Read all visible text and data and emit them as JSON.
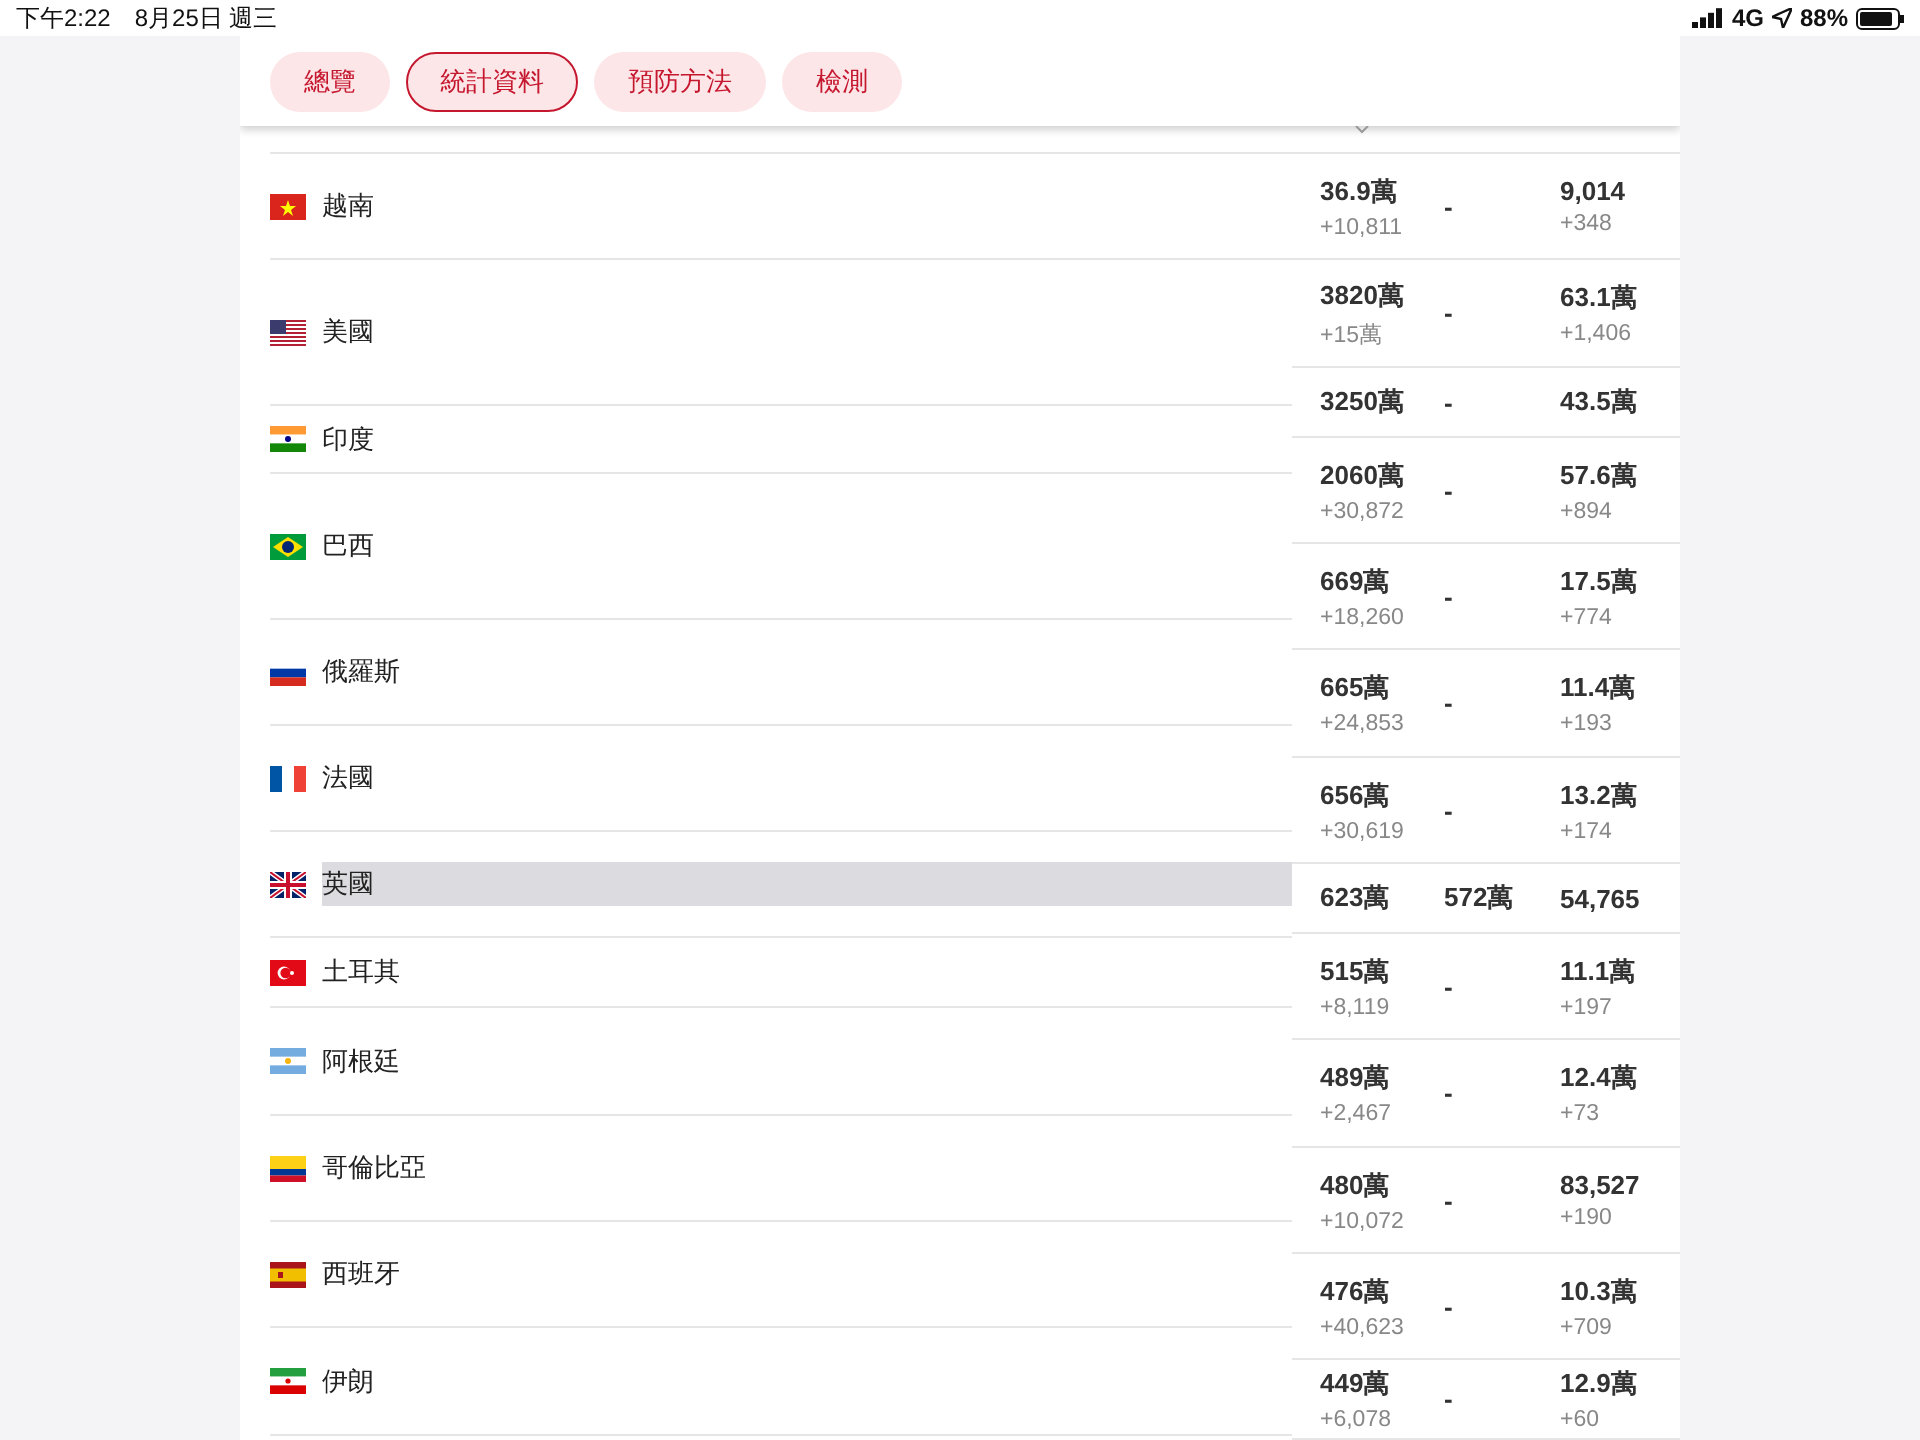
{
  "status_bar": {
    "time": "下午2:22",
    "date": "8月25日 週三",
    "network": "4G",
    "battery": "88%"
  },
  "tabs": [
    {
      "label": "總覽",
      "selected": false
    },
    {
      "label": "統計資料",
      "selected": true
    },
    {
      "label": "預防方法",
      "selected": false
    },
    {
      "label": "檢測",
      "selected": false
    }
  ],
  "table": {
    "names": [
      {
        "name": "越南",
        "selected": false
      },
      {
        "name": "美國",
        "selected": false
      },
      {
        "name": "印度",
        "selected": false
      },
      {
        "name": "巴西",
        "selected": false
      },
      {
        "name": "俄羅斯",
        "selected": false
      },
      {
        "name": "法國",
        "selected": false
      },
      {
        "name": "英國",
        "selected": true
      },
      {
        "name": "土耳其",
        "selected": false
      },
      {
        "name": "阿根廷",
        "selected": false
      },
      {
        "name": "哥倫比亞",
        "selected": false
      },
      {
        "name": "西班牙",
        "selected": false
      },
      {
        "name": "伊朗",
        "selected": false
      }
    ],
    "rows": [
      {
        "column_1": "36.9萬",
        "column_1_change": "+10,811",
        "column_2": "-",
        "column_3": "9,014",
        "column_3_change": "+348"
      },
      {
        "column_1": "3820萬",
        "column_1_change": "+15萬",
        "column_2": "-",
        "column_3": "63.1萬",
        "column_3_change": "+1,406"
      },
      {
        "column_1": "3250萬",
        "column_2": "-",
        "column_3": "43.5萬"
      },
      {
        "column_1": "2060萬",
        "column_1_change": "+30,872",
        "column_2": "-",
        "column_3": "57.6萬",
        "column_3_change": "+894"
      },
      {
        "column_1": "669萬",
        "column_1_change": "+18,260",
        "column_2": "-",
        "column_3": "17.5萬",
        "column_3_change": "+774"
      },
      {
        "column_1": "665萬",
        "column_1_change": "+24,853",
        "column_2": "-",
        "column_3": "11.4萬",
        "column_3_change": "+193"
      },
      {
        "column_1": "656萬",
        "column_1_change": "+30,619",
        "column_2": "-",
        "column_3": "13.2萬",
        "column_3_change": "+174"
      },
      {
        "column_1": "623萬",
        "column_2": "572萬",
        "column_3": "54,765"
      },
      {
        "column_1": "515萬",
        "column_1_change": "+8,119",
        "column_2": "-",
        "column_3": "11.1萬",
        "column_3_change": "+197"
      },
      {
        "column_1": "489萬",
        "column_1_change": "+2,467",
        "column_2": "-",
        "column_3": "12.4萬",
        "column_3_change": "+73"
      },
      {
        "column_1": "480萬",
        "column_1_change": "+10,072",
        "column_2": "-",
        "column_3": "83,527",
        "column_3_change": "+190"
      },
      {
        "column_1": "476萬",
        "column_1_change": "+40,623",
        "column_2": "-",
        "column_3": "10.3萬",
        "column_3_change": "+709"
      },
      {
        "column_1": "449萬",
        "column_1_change": "+6,078",
        "column_2": "-",
        "column_3": "12.9萬",
        "column_3_change": "+60"
      }
    ]
  }
}
